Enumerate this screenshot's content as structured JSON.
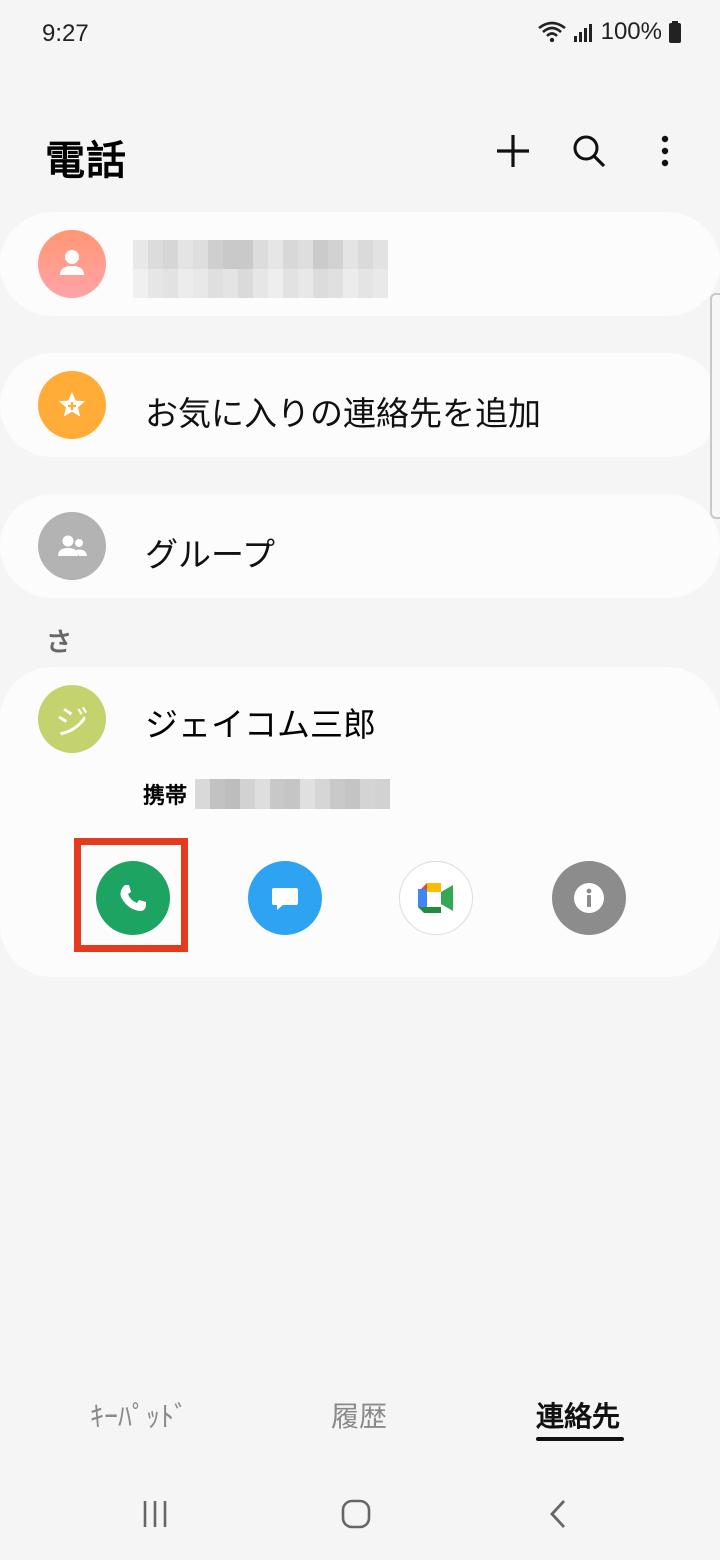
{
  "status_bar": {
    "time": "9:27",
    "battery": "100%",
    "icons": [
      "wifi-icon",
      "signal-icon",
      "battery-icon"
    ]
  },
  "header": {
    "title": "電話",
    "actions": [
      "add-icon",
      "search-icon",
      "more-options-icon"
    ]
  },
  "rows": {
    "profile": {
      "avatar_icon": "person-icon",
      "avatar_color": "#ff9a87"
    },
    "favorites": {
      "label": "お気に入りの連絡先を追加",
      "avatar_icon": "star-icon",
      "avatar_color": "#ffac38"
    },
    "groups": {
      "label": "グループ",
      "avatar_icon": "group-icon",
      "avatar_color": "#b3b3b3"
    }
  },
  "contacts": {
    "section_index": "さ",
    "contact": {
      "initial": "ジ",
      "name": "ジェイコム三郎",
      "phone_label": "携帯",
      "avatar_color": "#c5d36e",
      "actions": [
        "phone-icon",
        "message-icon",
        "meet-icon",
        "info-icon"
      ]
    }
  },
  "tabs": [
    {
      "label": "ｷｰﾊﾟｯﾄﾞ",
      "active": false
    },
    {
      "label": "履歴",
      "active": false
    },
    {
      "label": "連絡先",
      "active": true
    }
  ],
  "nav": [
    "recent-apps-icon",
    "home-icon",
    "back-icon"
  ],
  "colors": {
    "call_green": "#1da462",
    "message_blue": "#2ea3f2",
    "info_gray": "#8c8c8c",
    "highlight_red": "#e63a1f"
  }
}
